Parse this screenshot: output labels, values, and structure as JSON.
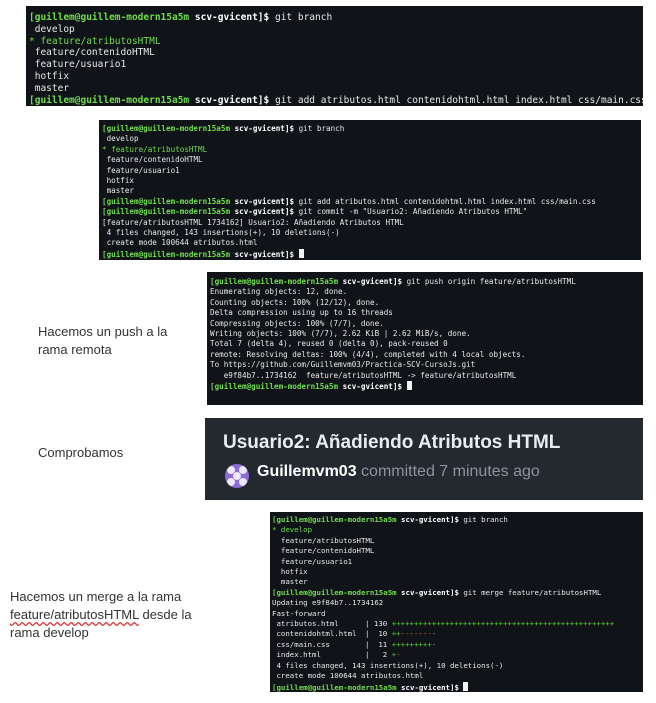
{
  "prompt": {
    "user": "[guillem@guillem-modern15a5m",
    "dir": "scv-gvicent]$"
  },
  "term1": {
    "cmd1": "git branch",
    "branches": [
      "develop",
      "feature/contenidoHTML",
      "feature/usuario1",
      "hotfix",
      "master"
    ],
    "current_branch": "* feature/atributosHTML",
    "cmd2": "git add atributos.html contenidohtml.html index.html css/main.css"
  },
  "term2": {
    "cmd1": "git branch",
    "current_branch": "* feature/atributosHTML",
    "branches": [
      "develop",
      "feature/contenidoHTML",
      "feature/usuario1",
      "hotfix",
      "master"
    ],
    "cmd2": "git add atributos.html contenidohtml.html index.html css/main.css",
    "cmd3": "git commit -m \"Usuario2: Añadiendo Atributos HTML\"",
    "out": [
      "[feature/atributosHTML 1734162] Usuario2: Añadiendo Atributos HTML",
      " 4 files changed, 143 insertions(+), 10 deletions(-)",
      " create mode 100644 atributos.html"
    ]
  },
  "term3": {
    "cmd": "git push origin feature/atributosHTML",
    "out": [
      "Enumerating objects: 12, done.",
      "Counting objects: 100% (12/12), done.",
      "Delta compression using up to 16 threads",
      "Compressing objects: 100% (7/7), done.",
      "Writing objects: 100% (7/7), 2.62 KiB | 2.62 MiB/s, done.",
      "Total 7 (delta 4), reused 0 (delta 0), pack-reused 0",
      "remote: Resolving deltas: 100% (4/4), completed with 4 local objects.",
      "To https://github.com/Guillemvm03/Practica-SCV-CursoJs.git",
      "   e9f84b7..1734162  feature/atributosHTML -> feature/atributosHTML"
    ]
  },
  "term4": {
    "cmd1": "git branch",
    "current_branch": "* develop",
    "branches": [
      "feature/atributosHTML",
      "feature/contenidoHTML",
      "feature/usuario1",
      "hotfix",
      "master"
    ],
    "cmd2": "git merge feature/atributosHTML",
    "out1": [
      "Updating e9f84b7..1734162",
      "Fast-forward"
    ],
    "files": [
      {
        "name": " atributos.html",
        "count": "130",
        "plus": "++++++++++++++++++++++++++++++++++++++++++++++++++",
        "minus": ""
      },
      {
        "name": " contenidohtml.html",
        "count": " 10",
        "plus": "++",
        "minus": "--------"
      },
      {
        "name": " css/main.css",
        "count": " 11",
        "plus": "+++++++++",
        "minus": "-"
      },
      {
        "name": " index.html",
        "count": "  2",
        "plus": "+",
        "minus": "-"
      }
    ],
    "out2": [
      " 4 files changed, 143 insertions(+), 10 deletions(-)",
      " create mode 100644 atributos.html"
    ]
  },
  "captions": {
    "push": "Hacemos un push a la rama remota",
    "check": "Comprobamos",
    "merge_line1": "Hacemos un merge a la rama",
    "merge_word": "feature/atributosHTML",
    "merge_line2b": " desde la",
    "merge_line3": "rama develop"
  },
  "github": {
    "commit_title": "Usuario2: Añadiendo Atributos HTML",
    "user": "Guillemvm03",
    "when": " committed 7 minutes ago"
  },
  "colors": {
    "prompt_green": "#6fdc4c",
    "terminal_bg": "#101418",
    "diff_plus": "#58c83c",
    "diff_minus": "#e5554b",
    "github_bg": "#24292f"
  }
}
